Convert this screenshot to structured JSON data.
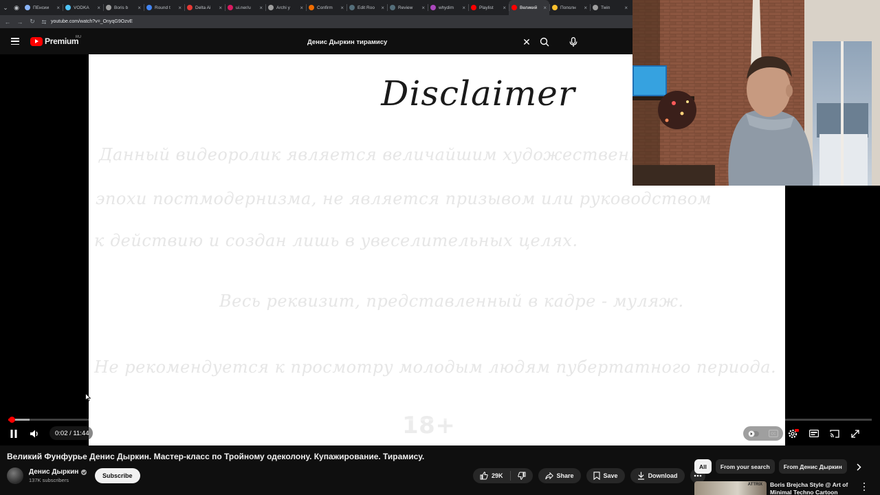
{
  "browser": {
    "tabs": [
      {
        "label": "ПЕнсии",
        "favicon_color": "#8ab4f8"
      },
      {
        "label": "VODKA",
        "favicon_color": "#4fc3f7"
      },
      {
        "label": "Boris b",
        "favicon_color": "#9e9e9e"
      },
      {
        "label": "Round t",
        "favicon_color": "#4285f4"
      },
      {
        "label": "Delta Ai",
        "favicon_color": "#e53935"
      },
      {
        "label": "ui.ner/u",
        "favicon_color": "#d81b60"
      },
      {
        "label": "Archi y",
        "favicon_color": "#9e9e9e"
      },
      {
        "label": "Confirm",
        "favicon_color": "#ef6c00"
      },
      {
        "label": "Edit Roo",
        "favicon_color": "#546e7a"
      },
      {
        "label": "Review",
        "favicon_color": "#546e7a"
      },
      {
        "label": "whydim",
        "favicon_color": "#ab47bc"
      },
      {
        "label": "Playlist",
        "favicon_color": "#ff0000"
      },
      {
        "label": "Великий",
        "favicon_color": "#ff0000",
        "active": true
      },
      {
        "label": "Пополн",
        "favicon_color": "#fbc02d"
      },
      {
        "label": "Twin",
        "favicon_color": "#9e9e9e"
      }
    ],
    "url": "youtube.com/watch?v=_OnyqG9OzvE"
  },
  "masthead": {
    "logo_text": "Premium",
    "country_code": "RU",
    "search_value": "Денис Дыркин тирамису"
  },
  "slide": {
    "heading": "Disclaimer",
    "lines": [
      "Данный видеоролик является величайшим художественным",
      "эпохи  постмодернизма, не является призывом или руководством",
      "к действию и создан лишь в увеселительных целях.",
      "Весь реквизит, представленный в кадре - муляж.",
      "Не рекомендуется к просмотру молодым людям пубертатного периода."
    ],
    "age_rating": "18+"
  },
  "player": {
    "time_text": "0:02 / 11:44",
    "played_fraction": 0.0028,
    "buffered_fraction": 0.025
  },
  "video": {
    "title": "Великий Фунфурье Денис Дыркин. Мастер-класс по Тройному одеколону. Купажирование. Тирамису.",
    "channel_name": "Денис Дыркин",
    "subscribers": "137K subscribers",
    "subscribe_label": "Subscribe",
    "likes": "29K",
    "share_label": "Share",
    "save_label": "Save",
    "download_label": "Download"
  },
  "chips": [
    "All",
    "From your search",
    "From Денис Дыркин"
  ],
  "related": {
    "thumb_text": "ATTRIX",
    "title": "Boris Brejcha Style @ Art of Minimal Techno Cartoon"
  }
}
